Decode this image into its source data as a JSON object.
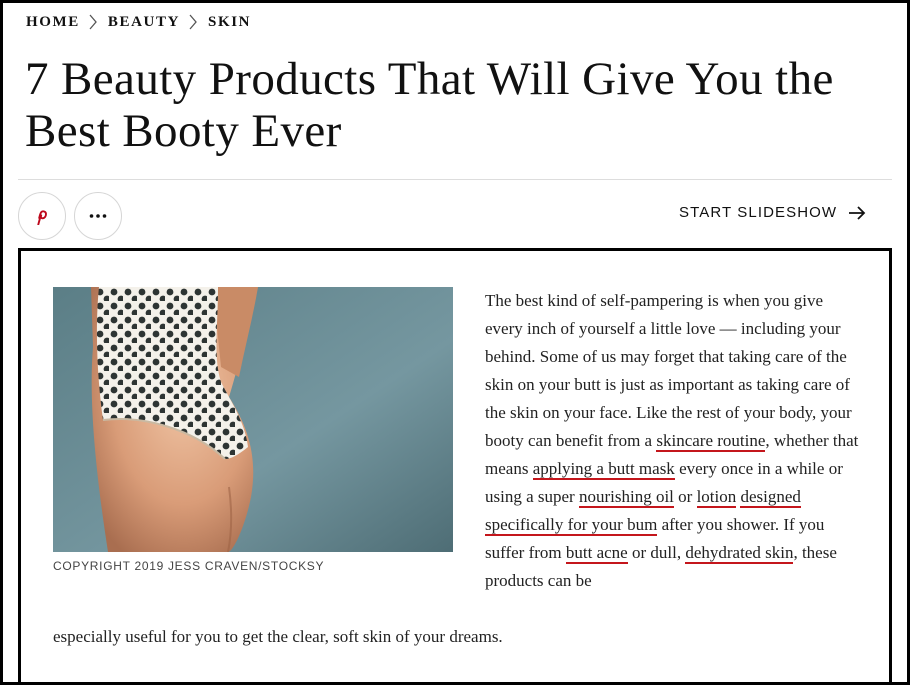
{
  "breadcrumb": {
    "items": [
      "HOME",
      "BEAUTY",
      "SKIN"
    ]
  },
  "article": {
    "title": "7 Beauty Products That Will Give You the Best Booty Ever",
    "caption": "COPYRIGHT 2019 JESS CRAVEN/STOCKSY",
    "body": {
      "t1": "The best kind of self-pampering is when you give every inch of yourself a little love — including your behind. Some of us may forget that taking care of the skin on your butt is just as important as taking care of the skin on your face. Like the rest of your body, your booty can benefit from a ",
      "l1": "skincare routine",
      "t2": ", whether that means ",
      "l2": "applying a butt mask",
      "t3": " every once in a while or using a super ",
      "l3": "nourishing oil",
      "t4": " or ",
      "l4a": "lotion",
      "l4b": "designed specifically for your bum",
      "t5": " after you shower. If you suffer from ",
      "l5": "butt acne",
      "t6": " or dull,",
      "l6": "dehydrated skin",
      "t7": ", these products can be",
      "t8": "especially useful for you to get the clear, soft skin of your dreams."
    }
  },
  "actions": {
    "pinterest_icon": "pinterest-icon",
    "more_icon": "more-icon",
    "slideshow_label": "START SLIDESHOW",
    "slideshow_icon": "arrow-right-icon"
  },
  "colors": {
    "link_underline": "#c4161c",
    "pinterest": "#bd081c",
    "photo_background": "#6d8c93"
  }
}
